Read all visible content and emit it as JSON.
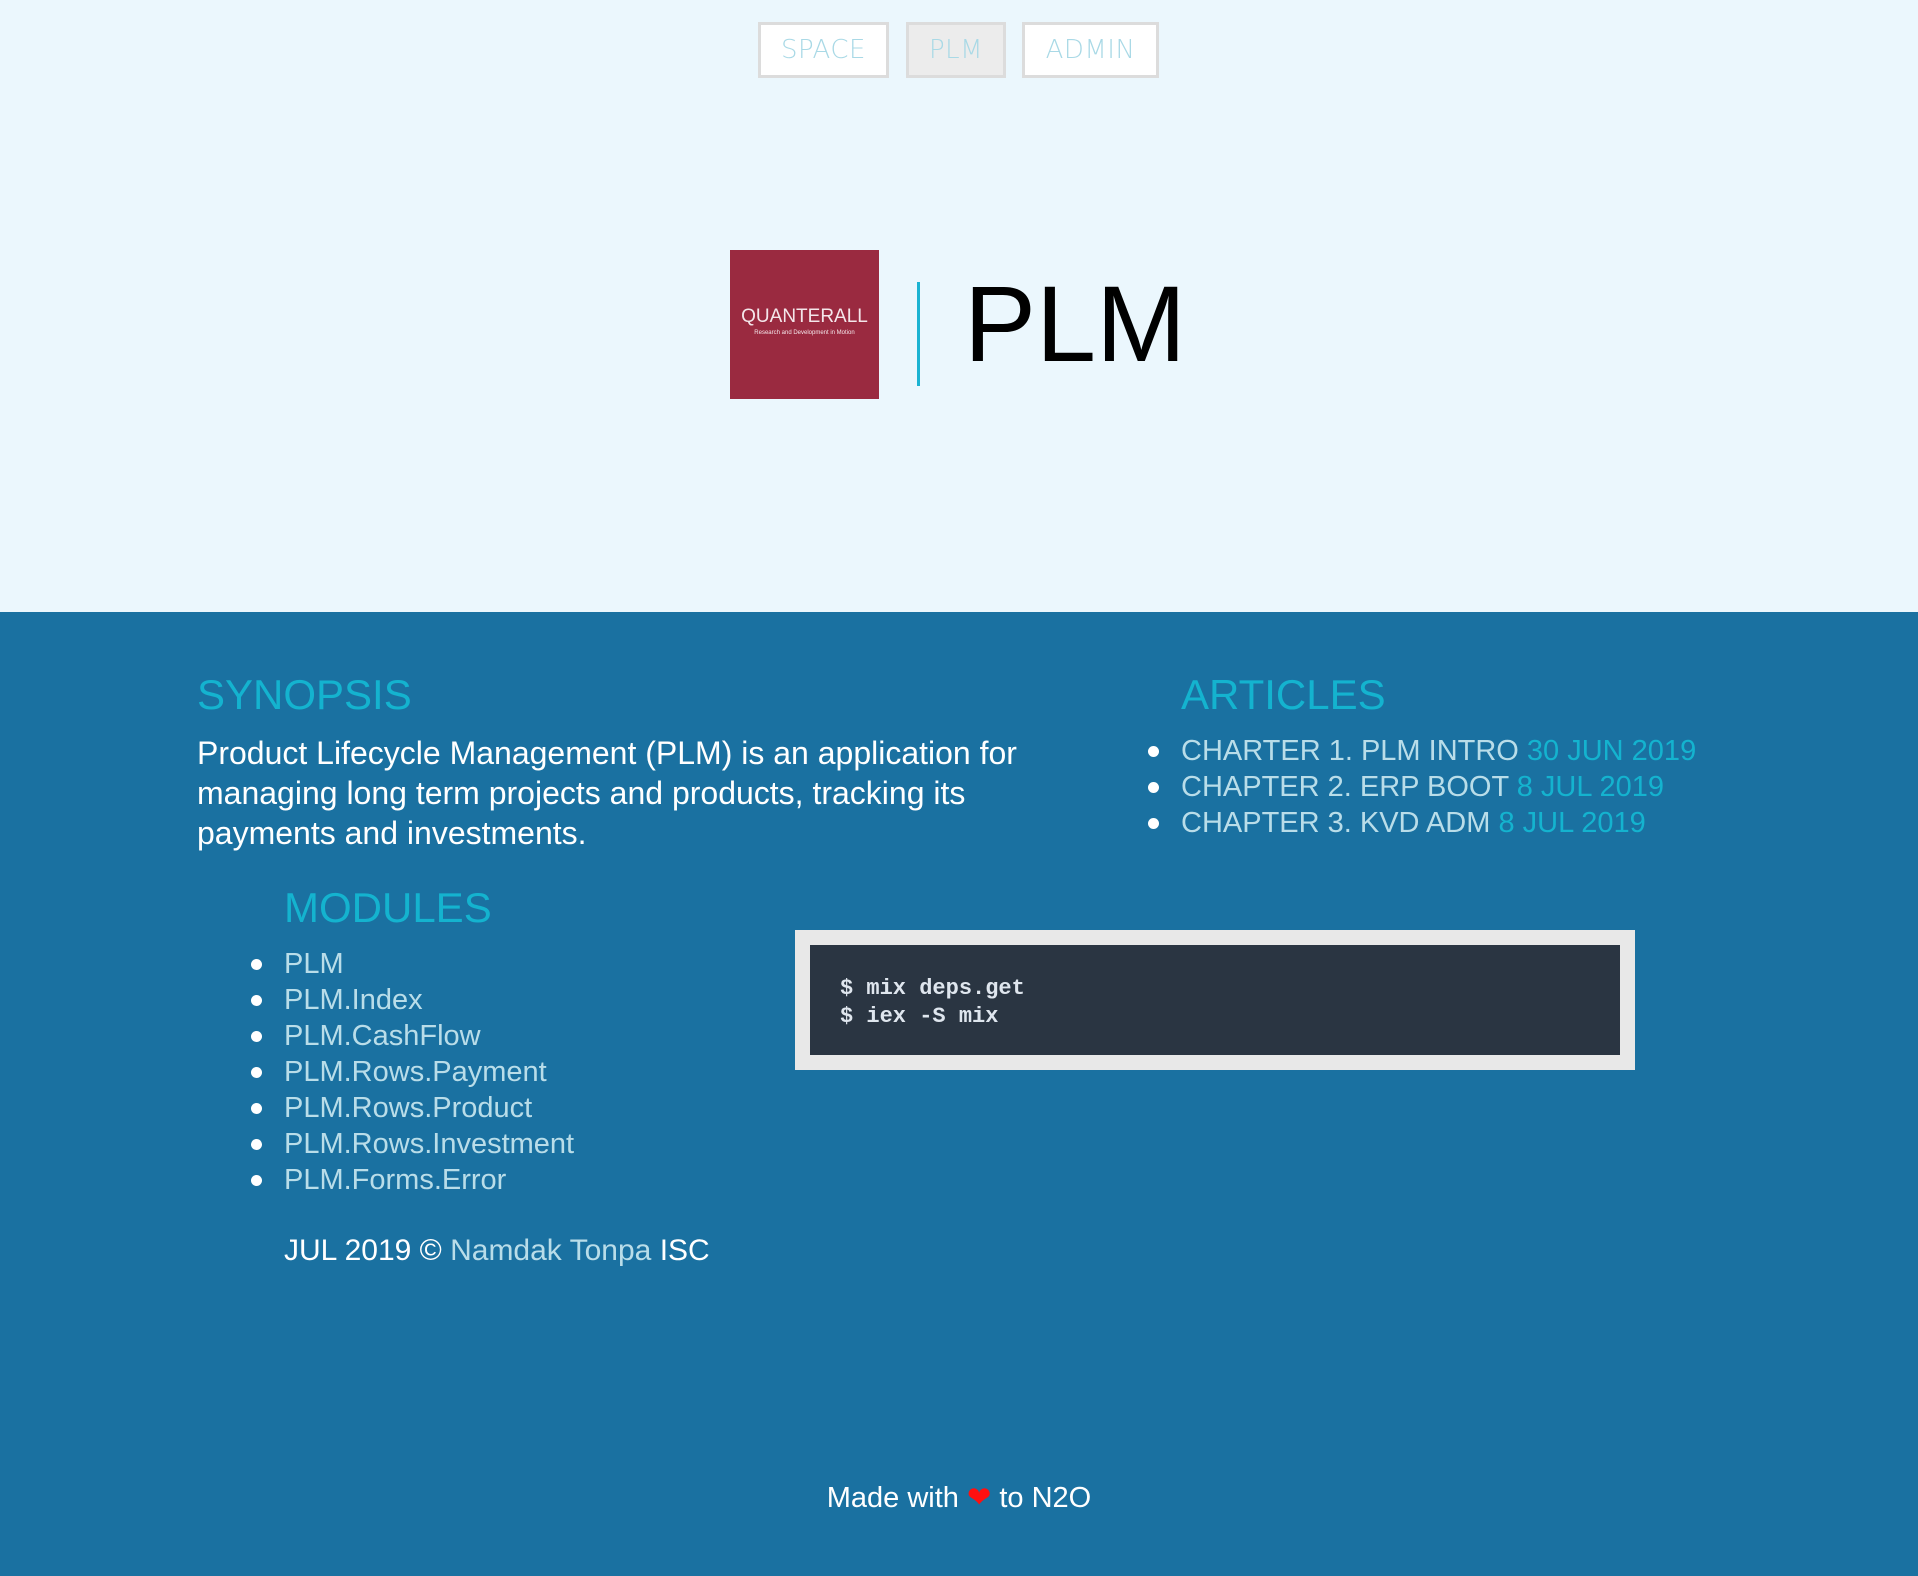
{
  "nav": [
    {
      "label": "SPACE",
      "active": false
    },
    {
      "label": "PLM",
      "active": true
    },
    {
      "label": "ADMIN",
      "active": false
    }
  ],
  "logo": {
    "name": "QUANTERALL",
    "tagline": "Research and Development in Motion"
  },
  "title": "PLM",
  "synopsis": {
    "heading": "SYNOPSIS",
    "text": "Product Lifecycle Management (PLM) is an application for managing long term projects and products, tracking its payments and investments."
  },
  "articles": {
    "heading": "ARTICLES",
    "items": [
      {
        "title": "CHARTER 1. PLM INTRO",
        "date": "30 JUN 2019"
      },
      {
        "title": "CHAPTER 2. ERP BOOT",
        "date": "8 JUL 2019"
      },
      {
        "title": "CHAPTER 3. KVD ADM",
        "date": "8 JUL 2019"
      }
    ]
  },
  "modules": {
    "heading": "MODULES",
    "items": [
      "PLM",
      "PLM.Index",
      "PLM.CashFlow",
      "PLM.Rows.Payment",
      "PLM.Rows.Product",
      "PLM.Rows.Investment",
      "PLM.Forms.Error"
    ]
  },
  "code": {
    "lines": [
      "$ mix deps.get",
      "$ iex -S mix"
    ]
  },
  "footer": {
    "date": "JUL 2019 ©",
    "author": "Namdak Tonpa",
    "suffix": "ISC",
    "made_prefix": "Made with",
    "heart": "❤",
    "made_suffix": "to N2O"
  },
  "colors": {
    "accent": "#14b3cf",
    "section": "#1a71a1",
    "logo": "#9a2a40"
  }
}
